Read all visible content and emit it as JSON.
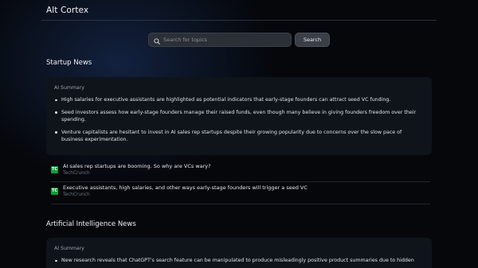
{
  "app": {
    "title": "Alt Cortex"
  },
  "search": {
    "placeholder": "Search for topics",
    "value": "",
    "button_label": "Search"
  },
  "sections": [
    {
      "title": "Startup News",
      "summary_label": "AI Summary",
      "bullets": [
        "High salaries for executive assistants are highlighted as potential indicators that early-stage founders can attract seed VC funding.",
        "Seed investors assess how early-stage founders manage their raised funds, even though many believe in giving founders freedom over their spending.",
        "Venture capitalists are hesitant to invest in AI sales rep startups despite their growing popularity due to concerns over the slow pace of business experimentation."
      ],
      "articles": [
        {
          "title": "AI sales rep startups are booming. So why are VCs wary?",
          "source": "TechCrunch",
          "icon": "techcrunch-icon"
        },
        {
          "title": "Executive assistants, high salaries, and other ways early-stage founders will trigger a seed VC",
          "source": "TechCrunch",
          "icon": "techcrunch-icon"
        }
      ]
    },
    {
      "title": "Artificial Intelligence News",
      "summary_label": "AI Summary",
      "bullets": [
        "New research reveals that ChatGPT's search feature can be manipulated to produce misleadingly positive product summaries due to hidden"
      ]
    }
  ],
  "icons": {
    "search": "search-icon",
    "source": "techcrunch-icon"
  },
  "colors": {
    "background": "#05070b",
    "card": "#0f141b",
    "techcrunch": "#0a9e3c"
  }
}
